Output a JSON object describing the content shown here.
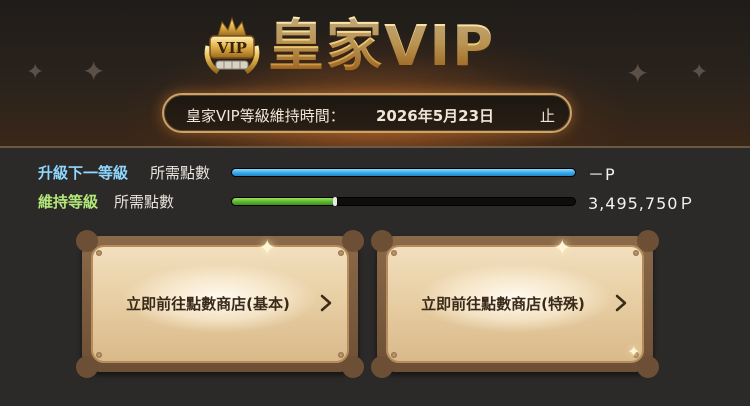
{
  "header": {
    "title": "皇家VIP",
    "badge_icon": "vip-crown-badge-icon",
    "maintain_label": "皇家VIP等級維持時間：",
    "maintain_date": "2026年5月23日",
    "maintain_suffix": "止"
  },
  "progress": {
    "next_level": {
      "label_strong": "升級下一等級",
      "label_sub": "所需點數",
      "value": "－P",
      "fill_fraction": 1.0,
      "color": "#34a3e6"
    },
    "maintain_level": {
      "label_strong": "維持等級",
      "label_sub": "所需點數",
      "value": "3,495,750Ｐ",
      "fill_fraction": 0.3,
      "color": "#55b22e"
    }
  },
  "buttons": {
    "basic_shop": "立即前往點數商店(基本)",
    "special_shop": "立即前往點數商店(特殊)"
  },
  "colors": {
    "accent_gold": "#f3cf79",
    "next_label": "#8fd7ff",
    "maintain_label": "#b4e77a"
  }
}
